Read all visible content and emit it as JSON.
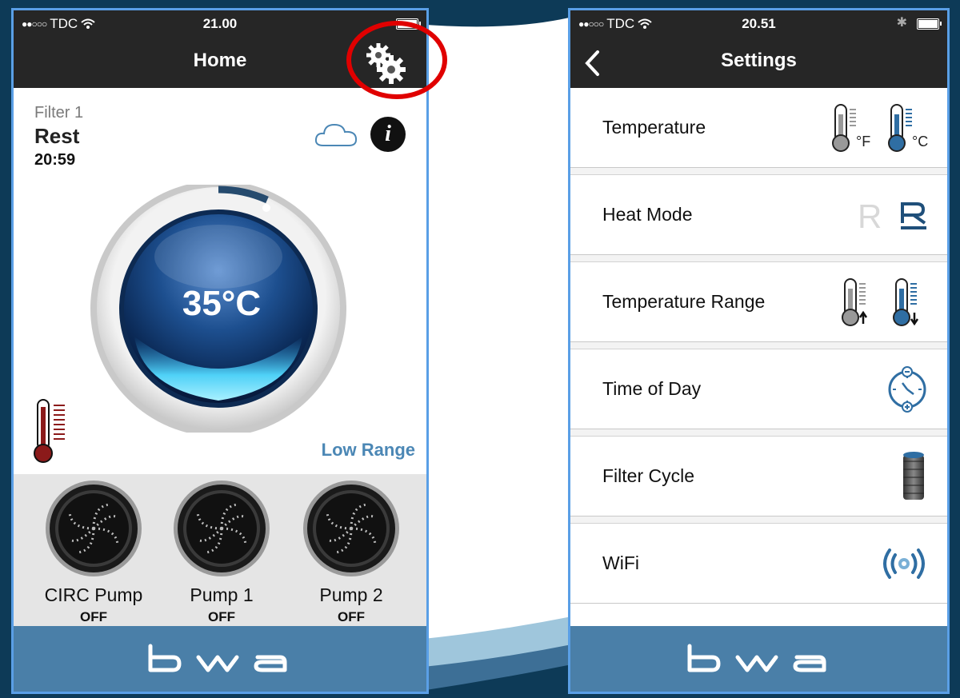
{
  "left_screen": {
    "status": {
      "carrier": "TDC",
      "time": "21.00"
    },
    "title": "Home",
    "filter": {
      "label": "Filter 1",
      "state": "Rest",
      "time": "20:59"
    },
    "temperature": "35°C",
    "range": "Low Range",
    "pumps": [
      {
        "name": "CIRC Pump",
        "state": "OFF"
      },
      {
        "name": "Pump 1",
        "state": "OFF"
      },
      {
        "name": "Pump 2",
        "state": "OFF"
      }
    ],
    "logo": "bwa"
  },
  "right_screen": {
    "status": {
      "carrier": "TDC",
      "time": "20.51"
    },
    "title": "Settings",
    "items": [
      {
        "label": "Temperature",
        "icons": [
          "thermometer-fahrenheit-icon",
          "thermometer-celsius-icon"
        ],
        "units": [
          "°F",
          "°C"
        ]
      },
      {
        "label": "Heat Mode",
        "icons": [
          "rest-mode-icon",
          "ready-mode-icon"
        ]
      },
      {
        "label": "Temperature Range",
        "icons": [
          "high-range-icon",
          "low-range-icon"
        ]
      },
      {
        "label": "Time of Day",
        "icons": [
          "clock-icon"
        ]
      },
      {
        "label": "Filter Cycle",
        "icons": [
          "filter-cartridge-icon"
        ]
      },
      {
        "label": "WiFi",
        "icons": [
          "wifi-signal-icon"
        ]
      }
    ],
    "logo": "bwa"
  },
  "colors": {
    "background": "#0d3a57",
    "bar": "#262626",
    "footer": "#4a7fa8",
    "accent_blue": "#4b87b5",
    "highlight_red": "#e00000",
    "thermometer_red": "#8b1a1a"
  }
}
